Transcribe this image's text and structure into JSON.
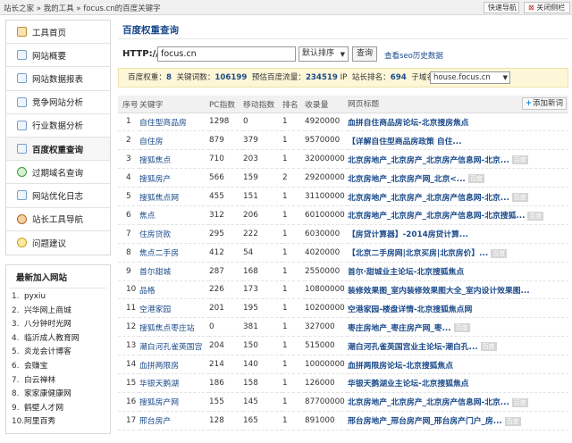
{
  "topbar": {
    "breadcrumb": "站长之家 » 我的工具 » focus.cn的百度关键字",
    "nav_button": "快速导航",
    "close_button": "关闭侧栏"
  },
  "sidebar": {
    "items": [
      {
        "label": "工具首页",
        "icon": "home-icon"
      },
      {
        "label": "网站概要",
        "icon": "document-icon"
      },
      {
        "label": "网站数据报表",
        "icon": "report-icon"
      },
      {
        "label": "竞争网站分析",
        "icon": "compare-icon"
      },
      {
        "label": "行业数据分析",
        "icon": "industry-icon"
      },
      {
        "label": "百度权重查询",
        "icon": "chart-icon"
      },
      {
        "label": "过期域名查询",
        "icon": "globe-icon"
      },
      {
        "label": "网站优化日志",
        "icon": "log-icon"
      },
      {
        "label": "站长工具导航",
        "icon": "tools-icon"
      },
      {
        "label": "问题建议",
        "icon": "chat-icon"
      }
    ],
    "active_index": 5
  },
  "new_sites": {
    "title": "最新加入网站",
    "items": [
      "pyxiu",
      "兴华网上商城",
      "八分钟时光网",
      "临沂成人教育网",
      "炎龙会计博客",
      "会赚宝",
      "白云禅林",
      "家家康健康网",
      "鹤壁人才网",
      "阿里百秀"
    ]
  },
  "main": {
    "title": "百度权重查询",
    "query_label": "HTTP://",
    "query_value": "focus.cn",
    "sort_selected": "默认排序",
    "query_button": "查询",
    "history_link": "查看seo历史数据"
  },
  "stats": {
    "weight_label": "百度权重：",
    "weight": "8",
    "keywords_label": "关键词数：",
    "keywords": "106199",
    "traffic_label": "预估百度流量：",
    "traffic": "234519",
    "traffic_unit": "IP",
    "rank_label": "站长排名：",
    "rank": "694",
    "subdomain_label": "子域名：",
    "subdomain_selected": "house.focus.cn"
  },
  "table": {
    "headers": [
      "序号",
      "关键字",
      "PC指数",
      "移动指数",
      "排名",
      "收录量",
      "网页标题"
    ],
    "add_button": "添加新词",
    "snapshot_label": "百度",
    "rows": [
      {
        "no": "1",
        "kw": "自住型商品房",
        "pc": "1298",
        "mobile": "0",
        "rank": "1",
        "indexed": "4920000",
        "title": "血拼自住商品房论坛-北京搜房焦点",
        "snapshot": false
      },
      {
        "no": "2",
        "kw": "自住房",
        "pc": "879",
        "mobile": "379",
        "rank": "1",
        "indexed": "9570000",
        "title": "【详解自住型商品房政策 自住...",
        "snapshot": false
      },
      {
        "no": "3",
        "kw": "搜狐焦点",
        "pc": "710",
        "mobile": "203",
        "rank": "1",
        "indexed": "32000000",
        "title": "北京房地产_北京房产_北京房产信息网-北京...",
        "snapshot": true
      },
      {
        "no": "4",
        "kw": "搜狐房产",
        "pc": "566",
        "mobile": "159",
        "rank": "2",
        "indexed": "29200000",
        "title": "北京房地产_北京房产网_北京<...",
        "snapshot": true
      },
      {
        "no": "5",
        "kw": "搜狐焦点网",
        "pc": "455",
        "mobile": "151",
        "rank": "1",
        "indexed": "31100000",
        "title": "北京房地产_北京房产_北京房产信息网-北京...",
        "snapshot": true
      },
      {
        "no": "6",
        "kw": "焦点",
        "pc": "312",
        "mobile": "206",
        "rank": "1",
        "indexed": "60100000",
        "title": "北京房地产_北京房产_北京房产信息网-北京搜狐...",
        "snapshot": true
      },
      {
        "no": "7",
        "kw": "住房贷款",
        "pc": "295",
        "mobile": "222",
        "rank": "1",
        "indexed": "6030000",
        "title": "【房贷计算器】-2014房贷计算...",
        "snapshot": false
      },
      {
        "no": "8",
        "kw": "焦点二手房",
        "pc": "412",
        "mobile": "54",
        "rank": "1",
        "indexed": "4020000",
        "title": "【北京二手房网|北京买房|北京房价】...",
        "snapshot": true
      },
      {
        "no": "9",
        "kw": "首尔甜城",
        "pc": "287",
        "mobile": "168",
        "rank": "1",
        "indexed": "2550000",
        "title": "首尔·甜城业主论坛-北京搜狐焦点",
        "snapshot": false
      },
      {
        "no": "10",
        "kw": "品格",
        "pc": "226",
        "mobile": "173",
        "rank": "1",
        "indexed": "10800000",
        "title": "装修效果图_室内装修效果图大全_室内设计效果图...",
        "snapshot": false
      },
      {
        "no": "11",
        "kw": "空港家园",
        "pc": "201",
        "mobile": "195",
        "rank": "1",
        "indexed": "10200000",
        "title": "空港家园-楼盘详情-北京搜狐焦点网",
        "snapshot": false
      },
      {
        "no": "12",
        "kw": "搜狐焦点枣庄站",
        "pc": "0",
        "mobile": "381",
        "rank": "1",
        "indexed": "327000",
        "title": "枣庄房地产_枣庄房产网_枣...",
        "snapshot": true
      },
      {
        "no": "13",
        "kw": "潮白河孔雀英国宫",
        "pc": "204",
        "mobile": "150",
        "rank": "1",
        "indexed": "515000",
        "title": "潮白河孔雀英国宫业主论坛-潮白孔...",
        "snapshot": true
      },
      {
        "no": "14",
        "kw": "血拼两限房",
        "pc": "214",
        "mobile": "140",
        "rank": "1",
        "indexed": "10000000",
        "title": "血拼两限房论坛-北京搜狐焦点",
        "snapshot": false
      },
      {
        "no": "15",
        "kw": "华银天鹅湖",
        "pc": "186",
        "mobile": "158",
        "rank": "1",
        "indexed": "126000",
        "title": "华银天鹅湖业主论坛-北京搜狐焦点",
        "snapshot": false
      },
      {
        "no": "16",
        "kw": "搜狐房产网",
        "pc": "155",
        "mobile": "145",
        "rank": "1",
        "indexed": "87700000",
        "title": "北京房地产_北京房产_北京房产信息网-北京...",
        "snapshot": true
      },
      {
        "no": "17",
        "kw": "邢台房产",
        "pc": "128",
        "mobile": "165",
        "rank": "1",
        "indexed": "891000",
        "title": "邢台房地产_邢台房产网_邢台房产门户_房...",
        "snapshot": true
      }
    ]
  }
}
